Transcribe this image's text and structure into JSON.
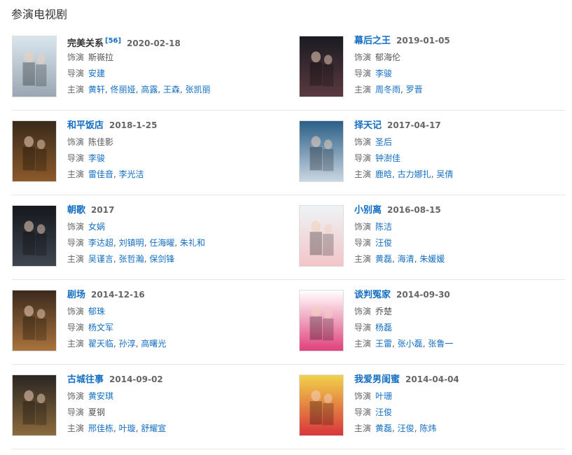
{
  "section_title": "参演电视剧",
  "labels": {
    "role": "饰演",
    "director": "导演",
    "cast": "主演"
  },
  "dramas": [
    {
      "title": "完美关系",
      "title_link": false,
      "ref": "[56]",
      "date": "2020-02-18",
      "role": "斯嶶拉",
      "role_link": false,
      "directors": [
        {
          "name": "安建",
          "link": true
        }
      ],
      "cast": [
        {
          "name": "黄轩",
          "link": true
        },
        {
          "name": "佟丽娅",
          "link": true
        },
        {
          "name": "高露",
          "link": true
        },
        {
          "name": "王森",
          "link": true
        },
        {
          "name": "张凯丽",
          "link": true
        }
      ],
      "poster_colors": [
        "#d9e6ee",
        "#9aa7b3"
      ]
    },
    {
      "title": "幕后之王",
      "title_link": true,
      "ref": "",
      "date": "2019-01-05",
      "role": "郁海伦",
      "role_link": false,
      "directors": [
        {
          "name": "李骏",
          "link": true
        }
      ],
      "cast": [
        {
          "name": "周冬雨",
          "link": true
        },
        {
          "name": "罗晋",
          "link": true
        }
      ],
      "poster_colors": [
        "#1b1b22",
        "#5a3a40"
      ]
    },
    {
      "title": "和平饭店",
      "title_link": true,
      "ref": "",
      "date": "2018-1-25",
      "role": "陈佳影",
      "role_link": false,
      "directors": [
        {
          "name": "李骏",
          "link": true
        }
      ],
      "cast": [
        {
          "name": "雷佳音",
          "link": true
        },
        {
          "name": "李光洁",
          "link": true
        }
      ],
      "poster_colors": [
        "#3a2a1a",
        "#8a5a2a"
      ]
    },
    {
      "title": "择天记",
      "title_link": true,
      "ref": "",
      "date": "2017-04-17",
      "role": "圣后",
      "role_link": true,
      "directors": [
        {
          "name": "钟澍佳",
          "link": true
        }
      ],
      "cast": [
        {
          "name": "鹿晗",
          "link": true
        },
        {
          "name": "古力娜扎",
          "link": true
        },
        {
          "name": "吴倩",
          "link": true
        }
      ],
      "poster_colors": [
        "#2b5f86",
        "#c9d6e2"
      ]
    },
    {
      "title": "朝歌",
      "title_link": true,
      "ref": "",
      "date": "2017",
      "role": "女娲",
      "role_link": true,
      "directors": [
        {
          "name": "李达超",
          "link": true
        },
        {
          "name": "刘镇明",
          "link": true
        },
        {
          "name": "任海曜",
          "link": true
        },
        {
          "name": "朱礼和",
          "link": true
        }
      ],
      "cast": [
        {
          "name": "吴谨言",
          "link": true
        },
        {
          "name": "张哲瀚",
          "link": true
        },
        {
          "name": "保剑锋",
          "link": true
        }
      ],
      "poster_colors": [
        "#15181d",
        "#3f4650"
      ]
    },
    {
      "title": "小别离",
      "title_link": true,
      "ref": "",
      "date": "2016-08-15",
      "role": "陈洁",
      "role_link": true,
      "directors": [
        {
          "name": "汪俊",
          "link": true
        }
      ],
      "cast": [
        {
          "name": "黄磊",
          "link": true
        },
        {
          "name": "海清",
          "link": true
        },
        {
          "name": "朱媛媛",
          "link": true
        }
      ],
      "poster_colors": [
        "#eef3f6",
        "#f2c5c8"
      ]
    },
    {
      "title": "剧场",
      "title_link": true,
      "ref": "",
      "date": "2014-12-16",
      "role": "郁珠",
      "role_link": true,
      "directors": [
        {
          "name": "杨文军",
          "link": true
        }
      ],
      "cast": [
        {
          "name": "翟天临",
          "link": true
        },
        {
          "name": "孙淳",
          "link": true
        },
        {
          "name": "高曙光",
          "link": true
        }
      ],
      "poster_colors": [
        "#3b2a1e",
        "#a8733c"
      ]
    },
    {
      "title": "谈判冤家",
      "title_link": true,
      "ref": "",
      "date": "2014-09-30",
      "role": "乔楚",
      "role_link": false,
      "directors": [
        {
          "name": "杨磊",
          "link": true
        }
      ],
      "cast": [
        {
          "name": "王雷",
          "link": true
        },
        {
          "name": "张小磊",
          "link": true
        },
        {
          "name": "张鲁一",
          "link": true
        }
      ],
      "poster_colors": [
        "#ffffff",
        "#e0407a"
      ]
    },
    {
      "title": "古城往事",
      "title_link": true,
      "ref": "",
      "date": "2014-09-02",
      "role": "黄安琪",
      "role_link": true,
      "directors": [
        {
          "name": "夏钢",
          "link": false
        }
      ],
      "cast": [
        {
          "name": "邢佳栋",
          "link": true
        },
        {
          "name": "叶璇",
          "link": true
        },
        {
          "name": "舒耀宣",
          "link": true
        }
      ],
      "poster_colors": [
        "#2b2622",
        "#8b6b3e"
      ]
    },
    {
      "title": "我爱男闺蜜",
      "title_link": true,
      "ref": "",
      "date": "2014-04-04",
      "role": "叶珊",
      "role_link": true,
      "directors": [
        {
          "name": "汪俊",
          "link": true
        }
      ],
      "cast": [
        {
          "name": "黄磊",
          "link": true
        },
        {
          "name": "汪俊",
          "link": true
        },
        {
          "name": "陈炜",
          "link": true
        }
      ],
      "poster_colors": [
        "#f1d24a",
        "#d8353b"
      ]
    }
  ]
}
